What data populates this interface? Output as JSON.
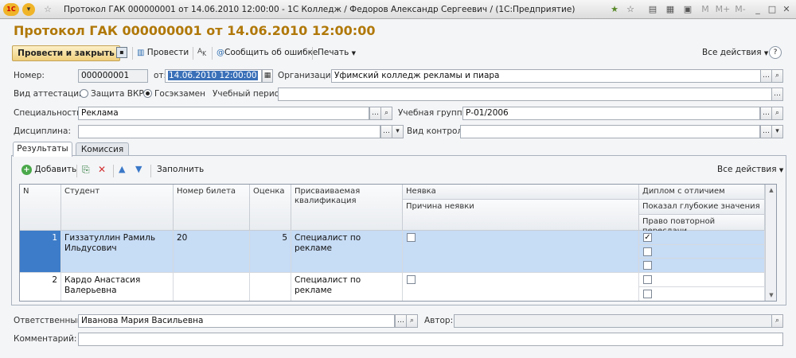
{
  "window": {
    "title": "Протокол ГАК 000000001 от 14.06.2010 12:00:00 - 1С Колледж / Федоров Александр Сергеевич / (1С:Предприятие)",
    "app_badge": "1С",
    "m_labels": [
      "M",
      "M+",
      "M-"
    ]
  },
  "doc_title": "Протокол ГАК 000000001 от 14.06.2010 12:00:00",
  "toolbar": {
    "post_close": "Провести и закрыть",
    "post": "Провести",
    "report_error": "Сообщить об ошибке",
    "print": "Печать",
    "all_actions": "Все действия",
    "help": "?"
  },
  "form": {
    "number_label": "Номер:",
    "number_value": "000000001",
    "from_label": "от:",
    "date_value": "14.06.2010 12:00:00",
    "org_label": "Организация:",
    "org_value": "Уфимский колледж рекламы и пиара",
    "attest_label": "Вид аттестации:",
    "radio_vkr": "Защита ВКР",
    "radio_gos": "Госэкзамен",
    "period_label": "Учебный период:",
    "period_value": "",
    "spec_label": "Специальность:",
    "spec_value": "Реклама",
    "group_label": "Учебная группа:",
    "group_value": "Р-01/2006",
    "disc_label": "Дисциплина:",
    "disc_value": "",
    "control_label": "Вид контроля:",
    "control_value": ""
  },
  "tabs": [
    {
      "label": "Результаты"
    },
    {
      "label": "Комиссия"
    }
  ],
  "grid_toolbar": {
    "add": "Добавить",
    "fill": "Заполнить",
    "all_actions": "Все действия"
  },
  "grid": {
    "headers": {
      "n": "N",
      "student": "Студент",
      "ticket": "Номер билета",
      "grade": "Оценка",
      "qual": "Присваиваемая квалификация",
      "absence": "Неявка",
      "absence_reason": "Причина неявки",
      "honors": "Диплом с отличием",
      "deep_knowledge": "Показал глубокие значения",
      "retake_right": "Право повторной пересдачи"
    },
    "rows": [
      {
        "n": "1",
        "student": "Гиззатуллин Рамиль Ильдусович",
        "ticket": "20",
        "grade": "5",
        "qual": "Специалист по рекламе",
        "absence": false,
        "honors": true,
        "deep": false,
        "retake": false
      },
      {
        "n": "2",
        "student": "Кардо Анастасия Валерьевна",
        "ticket": "",
        "grade": "",
        "qual": "Специалист по рекламе",
        "absence": false,
        "honors": false,
        "deep": false,
        "retake": null
      }
    ]
  },
  "footer": {
    "responsible_label": "Ответственный:",
    "responsible_value": "Иванова Мария Васильевна",
    "author_label": "Автор:",
    "author_value": "",
    "comment_label": "Комментарий:",
    "comment_value": ""
  }
}
